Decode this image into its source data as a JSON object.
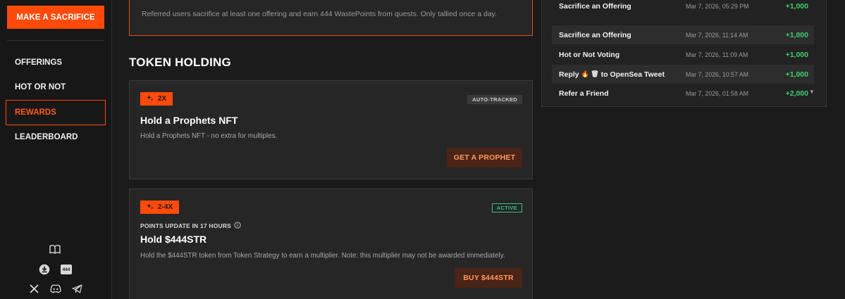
{
  "sidebar": {
    "cta_label": "MAKE A SACRIFICE",
    "nav": [
      {
        "label": "OFFERINGS",
        "active": false
      },
      {
        "label": "HOT OR NOT",
        "active": false
      },
      {
        "label": "REWARDS",
        "active": true
      },
      {
        "label": "LEADERBOARD",
        "active": false
      }
    ],
    "bottom_icons": [
      "book-icon",
      "download-icon",
      "444-icon",
      "x-icon",
      "discord-icon",
      "telegram-icon"
    ],
    "badge_444": "444"
  },
  "referral_card": {
    "text": "Referred users sacrifice at least one offering and earn 444 WastePoints from quests. Only tallied once a day."
  },
  "section": {
    "title": "TOKEN HOLDING"
  },
  "cards": [
    {
      "multiplier": "2X",
      "badge": "AUTO-TRACKED",
      "title": "Hold a Prophets NFT",
      "description": "Hold a Prophets NFT - no extra for multiples.",
      "button": "GET A PROPHET"
    },
    {
      "multiplier": "2-4X",
      "badge": "ACTIVE",
      "subtitle": "POINTS UPDATE IN 17 HOURS",
      "title": "Hold $444STR",
      "description": "Hold the $444STR token from Token Strategy to earn a multiplier. Note: this multiplier may not be awarded immediately.",
      "button": "BUY $444STR"
    }
  ],
  "activity": [
    {
      "name": "Sacrifice an Offering",
      "date": "Mar 7, 2026, 05:29 PM",
      "points": "+1,000"
    },
    {
      "name": "Sacrifice an Offering",
      "date": "Mar 7, 2026, 11:14 AM",
      "points": "+1,000"
    },
    {
      "name": "Hot or Not Voting",
      "date": "Mar 7, 2026, 11:09 AM",
      "points": "+1,000"
    },
    {
      "name_prefix": "Reply",
      "name_emojis": "🔥 🗑",
      "name_suffix": "to OpenSea Tweet",
      "date": "Mar 7, 2026, 10:57 AM",
      "points": "+1,000"
    },
    {
      "name": "Refer a Friend",
      "date": "Mar 7, 2026, 01:58 AM",
      "points": "+2,000"
    }
  ],
  "colors": {
    "accent": "#ff4a0a",
    "positive": "#3ecf6e",
    "active": "#2ec27e"
  }
}
